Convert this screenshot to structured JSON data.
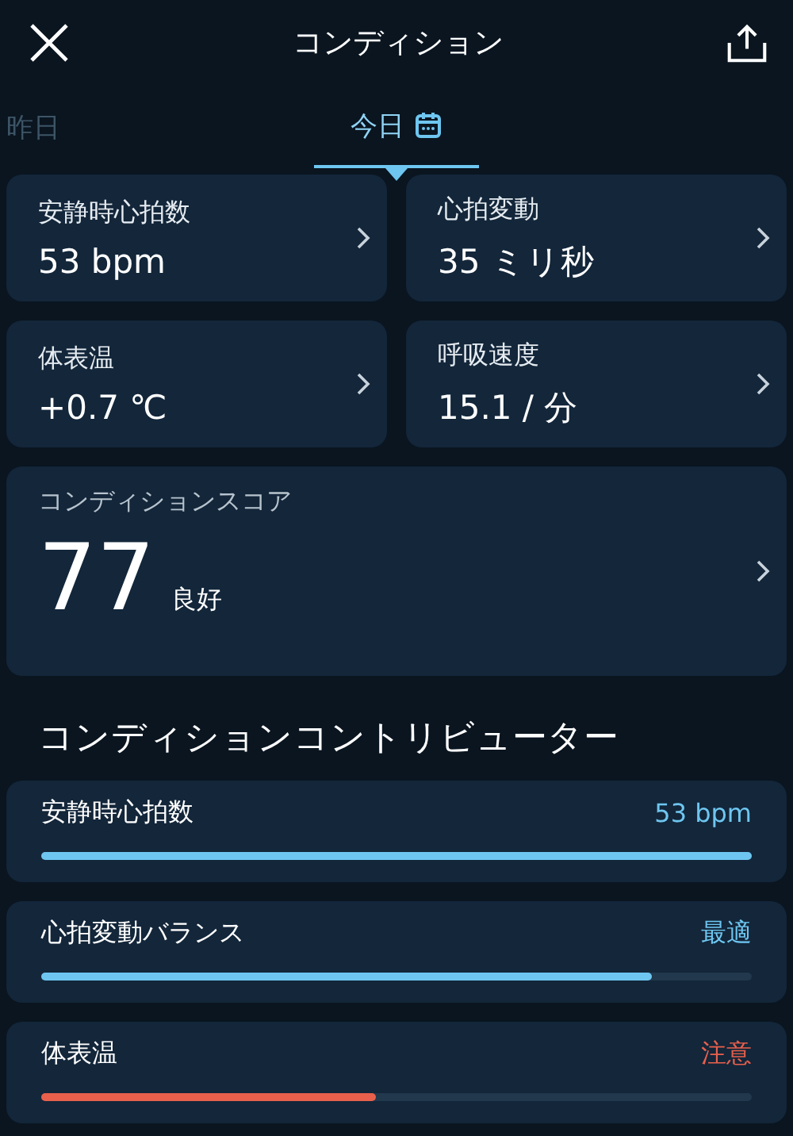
{
  "header": {
    "title": "コンディション"
  },
  "tabs": [
    {
      "label": "昨日",
      "selected": false
    },
    {
      "label": "今日",
      "selected": true
    }
  ],
  "metrics": [
    {
      "label": "安静時心拍数",
      "value": "53 bpm"
    },
    {
      "label": "心拍変動",
      "value": "35 ミリ秒"
    },
    {
      "label": "体表温",
      "value": "+0.7 ℃"
    },
    {
      "label": "呼吸速度",
      "value": "15.1 / 分"
    }
  ],
  "score": {
    "label": "コンディションスコア",
    "value": "77",
    "rating": "良好"
  },
  "contributors_title": "コンディションコントリビューター",
  "contributors": [
    {
      "label": "安静時心拍数",
      "status": "53 bpm",
      "level": 1.0,
      "color": "#6ec6f0"
    },
    {
      "label": "心拍変動バランス",
      "status": "最適",
      "level": 0.86,
      "color": "#6ec6f0"
    },
    {
      "label": "体表温",
      "status": "注意",
      "level": 0.47,
      "color": "#e8604c"
    }
  ]
}
